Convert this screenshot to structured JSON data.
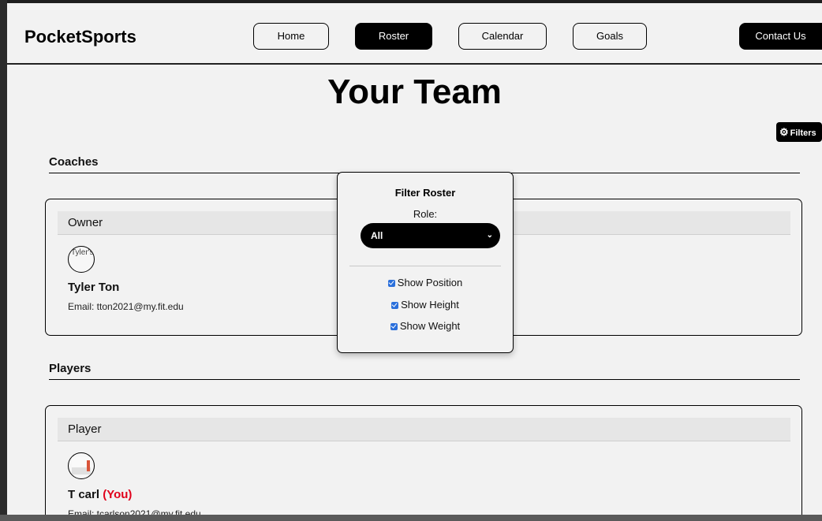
{
  "header": {
    "brand": "PocketSports",
    "nav": [
      {
        "label": "Home",
        "active": false
      },
      {
        "label": "Roster",
        "active": true
      },
      {
        "label": "Calendar",
        "active": false
      },
      {
        "label": "Goals",
        "active": false
      }
    ],
    "contact_label": "Contact Us"
  },
  "page": {
    "title": "Your Team",
    "filters_label": "Filters",
    "filters_icon": "gear-icon"
  },
  "coaches": {
    "section_title": "Coaches",
    "card": {
      "role": "Owner",
      "avatar_alt": "Tyler's",
      "name": "Tyler Ton",
      "email": "Email: tton2021@my.fit.edu"
    }
  },
  "players": {
    "section_title": "Players",
    "card": {
      "role": "Player",
      "name": "T carl",
      "you_label": "(You)",
      "email": "Email: tcarlson2021@my.fit.edu"
    }
  },
  "filter_popup": {
    "title": "Filter Roster",
    "role_label": "Role:",
    "role_selected": "All",
    "options": [
      {
        "label": "Show Position",
        "checked": true
      },
      {
        "label": "Show Height",
        "checked": true
      },
      {
        "label": "Show Weight",
        "checked": true
      }
    ]
  },
  "colors": {
    "accent_dark": "#000000",
    "you_highlight": "#e0001b",
    "checkbox": "#2a6fdb"
  }
}
